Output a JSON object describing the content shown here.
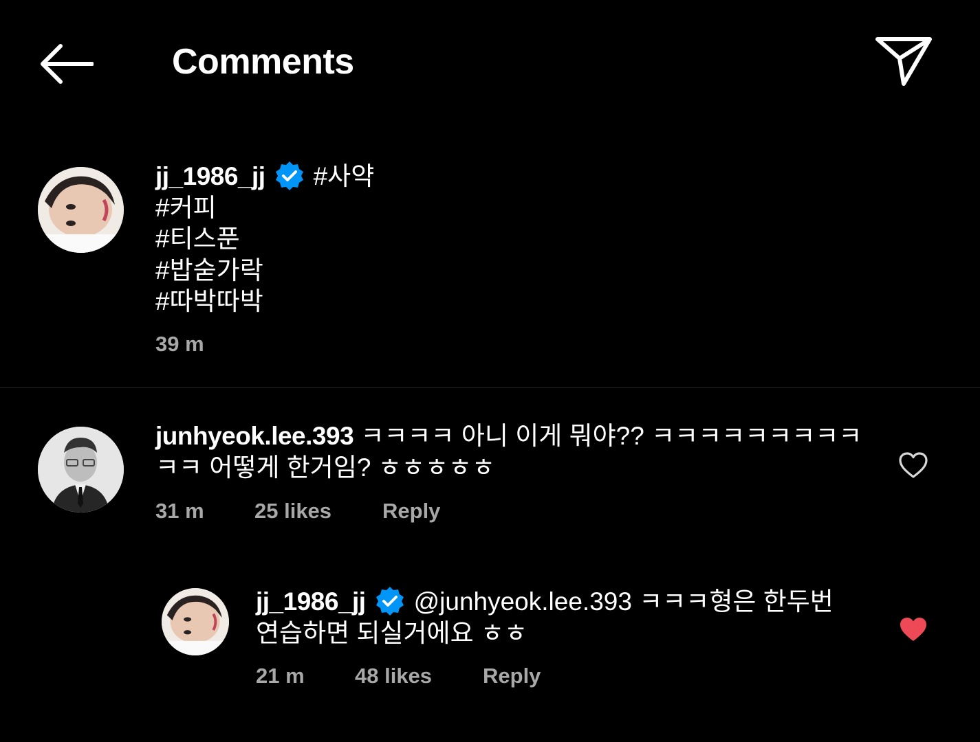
{
  "header": {
    "title": "Comments",
    "back_icon": "arrow-left-icon",
    "share_icon": "paper-plane-icon"
  },
  "caption": {
    "username": "jj_1986_jj",
    "verified": true,
    "lines": [
      "#사약",
      "#커피",
      "#티스푼",
      "#밥숟가락",
      "#따박따박"
    ],
    "time": "39 m"
  },
  "comments": [
    {
      "username": "junhyeok.lee.393",
      "verified": false,
      "text": "ㅋㅋㅋㅋ 아니 이게 뭐야?? ㅋㅋㅋㅋㅋㅋㅋㅋㅋㅋㅋ 어떻게 한거임? ㅎㅎㅎㅎㅎ",
      "time": "31 m",
      "likes": "25 likes",
      "reply_label": "Reply",
      "liked": false
    },
    {
      "username": "jj_1986_jj",
      "verified": true,
      "text": "@junhyeok.lee.393 ㅋㅋㅋ형은 한두번 연습하면 되실거에요 ㅎㅎ",
      "time": "21 m",
      "likes": "48 likes",
      "reply_label": "Reply",
      "liked": true
    }
  ],
  "colors": {
    "background": "#000000",
    "verified_blue": "#0095f6",
    "like_red": "#ed4956",
    "meta_gray": "#a8a8a8"
  }
}
